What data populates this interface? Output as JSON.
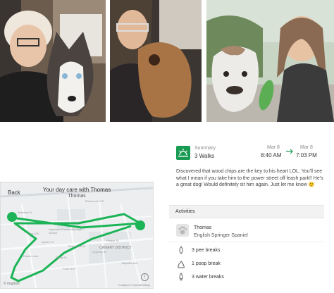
{
  "map": {
    "back_label": "Back",
    "title": "Your day care with Thomas",
    "subtitle": "Thomas",
    "roads": [
      "Richmond St E",
      "King St E",
      "Queen St",
      "Eastern Ave",
      "Trinity St",
      "Parliament St",
      "Palace St",
      "Cypress St",
      "Front St E",
      "Berkeley St",
      "Bayview Ave",
      "Ingenium Community High School",
      "CANARY DISTRICT"
    ],
    "logo": "© mapbox",
    "attribution": "© Mapbox © OpenStreetMap",
    "route_color": "#1cb456"
  },
  "summary": {
    "label": "Summary",
    "value": "3 Walks",
    "start_date": "Mar 8",
    "start_time": "8:40 AM",
    "end_date": "Mar 8",
    "end_time": "7:03 PM",
    "accent_color": "#1a9b54"
  },
  "note": "Discovered that wood chips are the key to his heart LOL. You'll see what I mean if you take him to the power street off leash park!! He's a great dog! Would definitely sit him again. Just let me know 😊",
  "activities": {
    "title": "Activities",
    "dog_name": "Thomas",
    "dog_breed": "English Springer Spaniel",
    "items": [
      {
        "icon": "pee-icon",
        "label": "3 pee breaks"
      },
      {
        "icon": "poop-icon",
        "label": "1 poop break"
      },
      {
        "icon": "water-icon",
        "label": "3 water breaks"
      }
    ]
  }
}
